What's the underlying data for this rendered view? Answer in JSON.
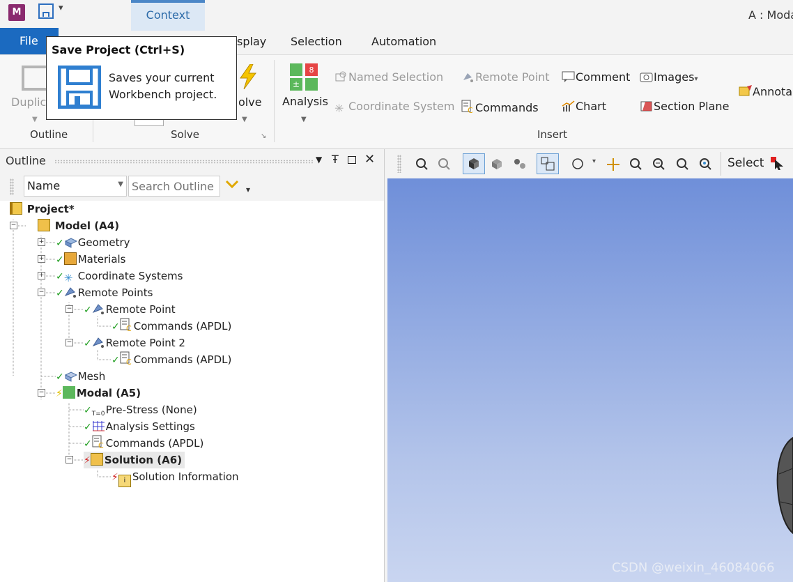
{
  "app": {
    "logo_letter": "M",
    "window_title": "A : Moda"
  },
  "quick_access": {
    "dropdown_glyph": "▾"
  },
  "context_tab": {
    "label": "Context"
  },
  "ribbon_tabs": {
    "file": "File",
    "display_partial": "splay",
    "selection": "Selection",
    "automation": "Automation"
  },
  "tooltip": {
    "title": "Save Project (Ctrl+S)",
    "line1": "Saves your current",
    "line2": "Workbench project."
  },
  "ribbon": {
    "outline_group": {
      "label": "Outline",
      "duplicate_partial": "Duplic"
    },
    "solve_group": {
      "label": "Solve",
      "solve_partial": "olve"
    },
    "insert_group": {
      "label": "Insert",
      "analysis": "Analysis",
      "named_selection": "Named Selection",
      "coordinate_system": "Coordinate System",
      "remote_point": "Remote Point",
      "commands": "Commands",
      "comment": "Comment",
      "chart": "Chart",
      "images": "Images",
      "section_plane": "Section Plane",
      "annotation_partial": "Annota"
    }
  },
  "outline": {
    "title": "Outline",
    "filter_select": "Name",
    "search_placeholder": "Search Outline",
    "tree": {
      "project": "Project*",
      "model": "Model (A4)",
      "geometry": "Geometry",
      "materials": "Materials",
      "coordinate_systems": "Coordinate Systems",
      "remote_points": "Remote Points",
      "remote_point_1": "Remote Point",
      "commands_1": "Commands (APDL)",
      "remote_point_2": "Remote Point 2",
      "commands_2": "Commands (APDL)",
      "mesh": "Mesh",
      "modal": "Modal (A5)",
      "pre_stress": "Pre-Stress (None)",
      "analysis_settings": "Analysis Settings",
      "commands_3": "Commands (APDL)",
      "solution": "Solution (A6)",
      "solution_information": "Solution Information"
    }
  },
  "graphics_toolbar": {
    "select_label": "Select"
  },
  "watermark": "CSDN @weixin_46084066"
}
